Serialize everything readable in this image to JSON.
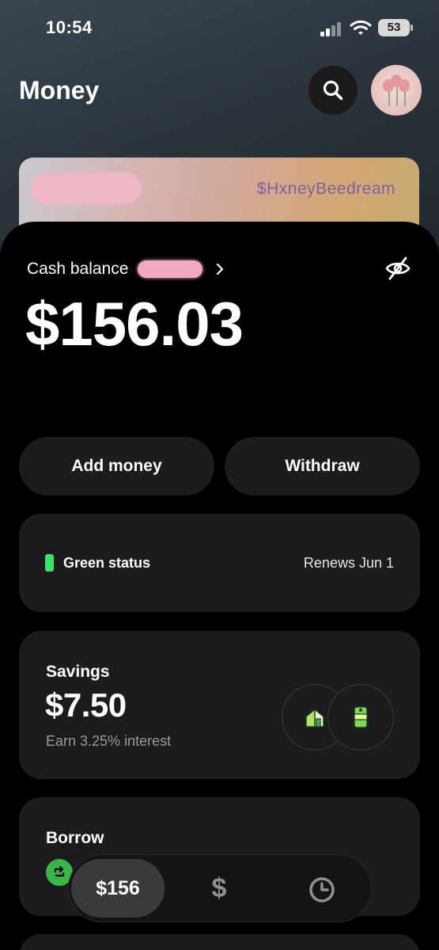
{
  "status_bar": {
    "time": "10:54",
    "battery": "53"
  },
  "header": {
    "title": "Money"
  },
  "card": {
    "cashtag": "$HxneyBeedream"
  },
  "balance": {
    "label": "Cash balance",
    "amount": "$156.03"
  },
  "actions": {
    "add_money": "Add money",
    "withdraw": "Withdraw"
  },
  "status": {
    "label": "Green status",
    "renews": "Renews Jun 1",
    "color": "#3ee06b"
  },
  "savings": {
    "title": "Savings",
    "amount": "$7.50",
    "subtitle": "Earn 3.25% interest"
  },
  "borrow": {
    "title": "Borrow"
  },
  "nav": {
    "balance": "$156",
    "dollar": "$"
  },
  "icons": [
    "search-icon",
    "avatar",
    "chevron-right-icon",
    "eye-slash-icon",
    "house-icon",
    "cash-roll-icon",
    "borrow-icon",
    "dollar-icon",
    "clock-icon"
  ]
}
